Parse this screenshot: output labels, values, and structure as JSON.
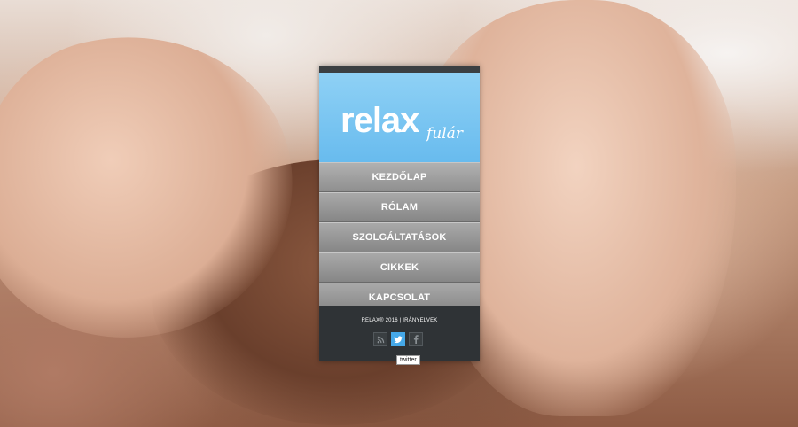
{
  "brand": {
    "logo_main": "relax",
    "logo_sub": "fulár"
  },
  "nav": {
    "items": [
      {
        "label": "KEZDŐLAP"
      },
      {
        "label": "RÓLAM"
      },
      {
        "label": "SZOLGÁLTATÁSOK"
      },
      {
        "label": "CIKKEK"
      },
      {
        "label": "KAPCSOLAT"
      }
    ]
  },
  "footer": {
    "text": "RELAX® 2016 | IRÁNYELVEK",
    "socials": [
      {
        "icon": "rss-icon"
      },
      {
        "icon": "twitter-icon",
        "active": true
      },
      {
        "icon": "facebook-icon"
      }
    ],
    "tooltip": "twitter"
  },
  "colors": {
    "header_blue": "#6fc0f0",
    "twitter_blue": "#45a8e8",
    "panel_dark": "#2f3336"
  }
}
